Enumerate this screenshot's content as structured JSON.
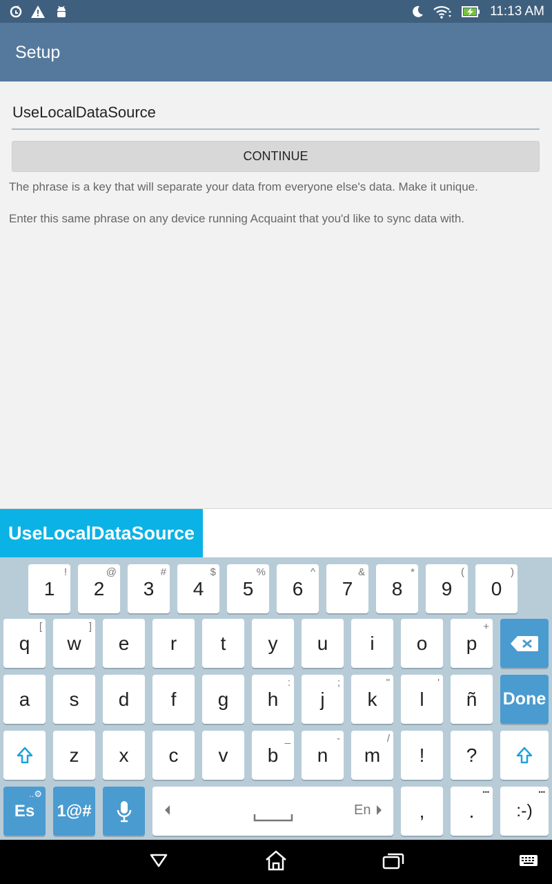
{
  "status_bar": {
    "time": "11:13 AM"
  },
  "app_bar": {
    "title": "Setup"
  },
  "form": {
    "phrase_value": "UseLocalDataSource",
    "continue_label": "CONTINUE",
    "help_text_1": "The phrase is a key that will separate your data from everyone else's data. Make it unique.",
    "help_text_2": "Enter this same phrase on any device running Acquaint that you'd like to sync data with."
  },
  "suggestion_bar": {
    "suggestion": "UseLocalDataSource"
  },
  "keyboard": {
    "number_row": [
      {
        "main": "1",
        "hint": "!"
      },
      {
        "main": "2",
        "hint": "@"
      },
      {
        "main": "3",
        "hint": "#"
      },
      {
        "main": "4",
        "hint": "$"
      },
      {
        "main": "5",
        "hint": "%"
      },
      {
        "main": "6",
        "hint": "^"
      },
      {
        "main": "7",
        "hint": "&"
      },
      {
        "main": "8",
        "hint": "*"
      },
      {
        "main": "9",
        "hint": "("
      },
      {
        "main": "0",
        "hint": ")"
      }
    ],
    "row1": [
      {
        "main": "q",
        "hint": "["
      },
      {
        "main": "w",
        "hint": "]"
      },
      {
        "main": "e",
        "hint": ""
      },
      {
        "main": "r",
        "hint": ""
      },
      {
        "main": "t",
        "hint": ""
      },
      {
        "main": "y",
        "hint": ""
      },
      {
        "main": "u",
        "hint": ""
      },
      {
        "main": "i",
        "hint": ""
      },
      {
        "main": "o",
        "hint": ""
      },
      {
        "main": "p",
        "hint": "+"
      }
    ],
    "row2": [
      {
        "main": "a",
        "hint": ""
      },
      {
        "main": "s",
        "hint": ""
      },
      {
        "main": "d",
        "hint": ""
      },
      {
        "main": "f",
        "hint": ""
      },
      {
        "main": "g",
        "hint": ""
      },
      {
        "main": "h",
        "hint": ":"
      },
      {
        "main": "j",
        "hint": ";"
      },
      {
        "main": "k",
        "hint": "\""
      },
      {
        "main": "l",
        "hint": "'"
      },
      {
        "main": "ñ",
        "hint": ""
      }
    ],
    "row3": [
      {
        "main": "z",
        "hint": ""
      },
      {
        "main": "x",
        "hint": ""
      },
      {
        "main": "c",
        "hint": ""
      },
      {
        "main": "v",
        "hint": ""
      },
      {
        "main": "b",
        "hint": "_"
      },
      {
        "main": "n",
        "hint": "-"
      },
      {
        "main": "m",
        "hint": "/"
      },
      {
        "main": "!",
        "hint": ""
      },
      {
        "main": "?",
        "hint": ""
      }
    ],
    "done_label": "Done",
    "lang_label": "Es",
    "symbols_label": "1@#",
    "space_lang": "En",
    "comma": ",",
    "period": ".",
    "period_hint": "•••",
    "smiley": ":-)",
    "smiley_hint": "•••"
  },
  "colors": {
    "status_bar": "#3f5f7e",
    "app_bar": "#55799d",
    "suggestion_chip": "#0bb2e6",
    "keyboard_func": "#4a9bd0"
  }
}
